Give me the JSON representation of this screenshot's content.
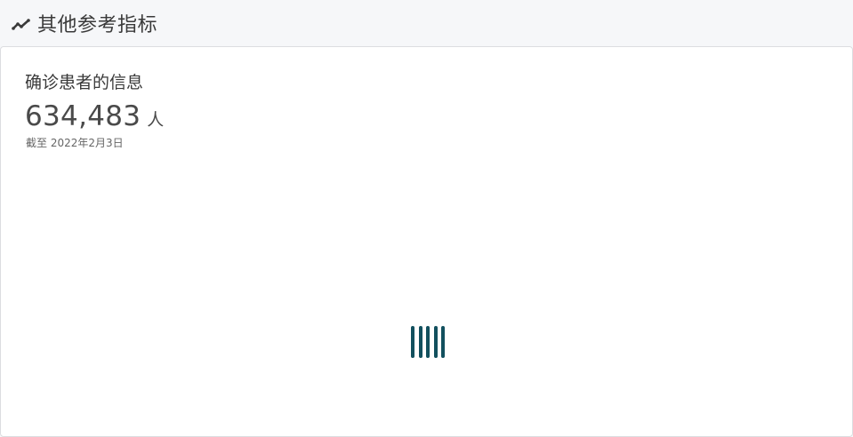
{
  "section": {
    "icon": "trend-line-icon",
    "title": "其他参考指标"
  },
  "card": {
    "title": "确诊患者的信息",
    "value": "634,483",
    "unit": "人",
    "note": "截至 2022年2月3日"
  },
  "loader": {
    "icon": "loading-bars-icon",
    "bar_count": 5,
    "color": "#12505e"
  },
  "colors": {
    "background": "#f6f7f9",
    "card_background": "#ffffff",
    "border": "#dcdde0"
  }
}
